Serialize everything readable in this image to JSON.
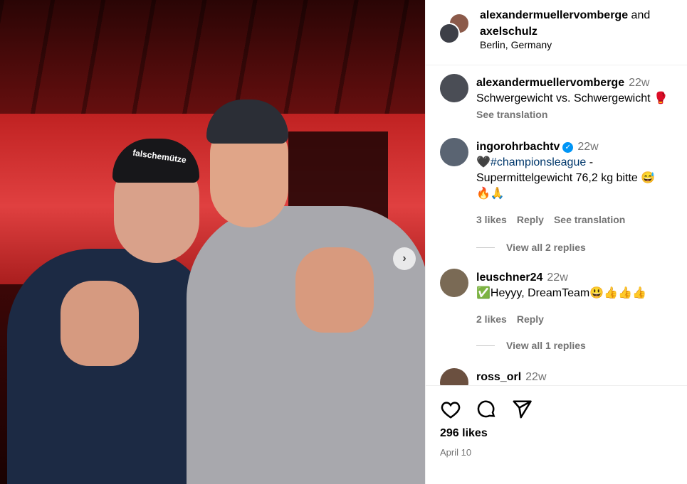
{
  "header": {
    "user1": "alexandermuellervomberge",
    "conj": "and",
    "user2": "axelschulz",
    "location": "Berlin, Germany"
  },
  "media": {
    "cap_text": "falschemütze"
  },
  "comments": [
    {
      "user": "alexandermuellervomberge",
      "time": "22w",
      "text": "Schwergewicht vs. Schwergewicht 🥊",
      "see_translation": "See translation"
    },
    {
      "user": "ingorohrbachtv",
      "time": "22w",
      "verified": true,
      "hashtag": "#championsleague",
      "text_line1_suffix": " -",
      "text_line2": "Supermittelgewicht 76,2 kg bitte 😅",
      "text_line3": "🔥🙏",
      "likes": "3 likes",
      "reply": "Reply",
      "see_translation": "See translation",
      "view_replies": "View all 2 replies"
    },
    {
      "user": "leuschner24",
      "time": "22w",
      "text": "✅Heyyy, DreamTeam😃👍👍👍",
      "likes": "2 likes",
      "reply": "Reply",
      "view_replies": "View all 1 replies"
    },
    {
      "user": "ross_orl",
      "time": "22w"
    }
  ],
  "footer": {
    "likes": "296 likes",
    "date": "April 10"
  },
  "icons": [
    "heart-icon",
    "comment-icon",
    "share-icon",
    "verified-icon",
    "chevron-right-icon"
  ]
}
